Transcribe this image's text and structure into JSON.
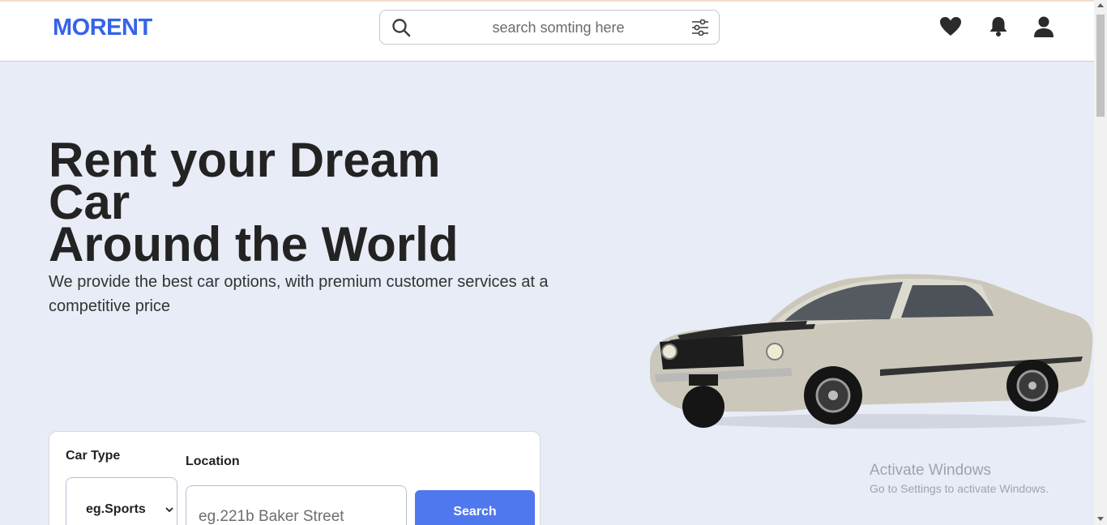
{
  "brand": {
    "name": "MORENT",
    "color": "#3563e9"
  },
  "search": {
    "placeholder": "search somting here"
  },
  "header_icons": [
    "search-icon",
    "filter-icon",
    "heart-icon",
    "bell-icon",
    "user-icon"
  ],
  "hero": {
    "title_line1": "Rent your Dream",
    "title_line2": "Car",
    "title_line3": "Around the World",
    "subtitle": "We provide the best car options, with premium customer services at a competitive price"
  },
  "form": {
    "car_type_label": "Car Type",
    "car_type_value": "eg.Sports",
    "location_label": "Location",
    "location_placeholder": "eg.221b Baker Street",
    "search_label": "Search"
  },
  "watermark": {
    "title": "Activate Windows",
    "subtitle": "Go to Settings to activate Windows."
  },
  "colors": {
    "accent": "#3563e9",
    "button": "#5078ee",
    "background": "#e8ecf6"
  }
}
